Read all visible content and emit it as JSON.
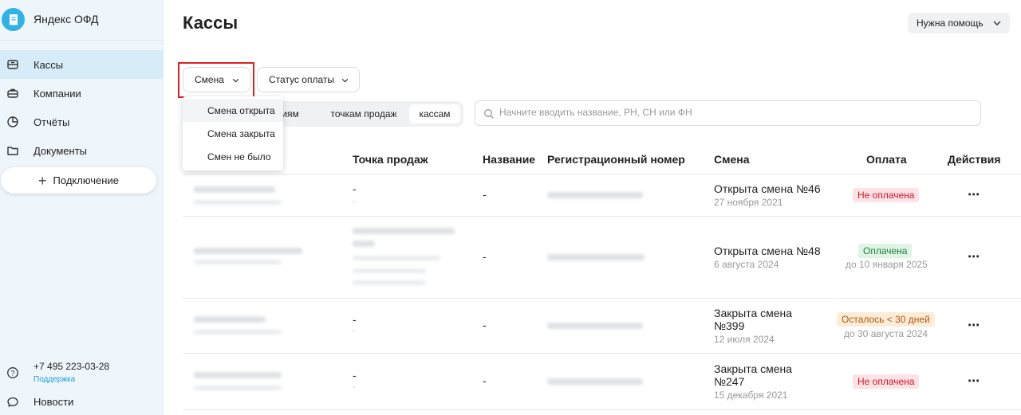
{
  "brand": {
    "name": "Яндекс ОФД"
  },
  "sidebar": {
    "items": [
      {
        "label": "Кассы"
      },
      {
        "label": "Компании"
      },
      {
        "label": "Отчёты"
      },
      {
        "label": "Документы"
      }
    ],
    "connect_label": "Подключение",
    "phone": "+7 495 223-03-28",
    "support_label": "Поддержка",
    "news_label": "Новости"
  },
  "header": {
    "title": "Кассы",
    "help_label": "Нужна помощь"
  },
  "filters": {
    "shift_label": "Смена",
    "payment_label": "Статус оплаты",
    "group_partial": "иям",
    "group_points": "точкам продаж",
    "group_registers": "кассам",
    "search_placeholder": "Начните вводить название, РН, СН или ФН"
  },
  "shift_dropdown": {
    "options": [
      "Смена открыта",
      "Смена закрыта",
      "Смен не было"
    ]
  },
  "table": {
    "headers": {
      "point": "Точка продаж",
      "name": "Название",
      "reg": "Регистрационный номер",
      "shift": "Смена",
      "payment": "Оплата",
      "actions": "Действия"
    },
    "rows": [
      {
        "point": "-",
        "point_sub": "-",
        "name": "-",
        "shift_l1": "Открыта смена №46",
        "shift_l2": "",
        "shift_date": "27 ноября 2021",
        "payment": "Не оплачена",
        "payment_sub": "",
        "dots": "⋯"
      },
      {
        "point": "",
        "point_sub": "",
        "name": "-",
        "shift_l1": "Открыта смена №48",
        "shift_l2": "",
        "shift_date": "6 августа 2024",
        "payment": "Оплачена",
        "payment_sub": "до 10 января 2025",
        "dots": "⋯"
      },
      {
        "point": "-",
        "point_sub": "-",
        "name": "-",
        "shift_l1": "Закрыта смена",
        "shift_l2": "№399",
        "shift_date": "12 июля 2024",
        "payment": "Осталось < 30 дней",
        "payment_sub": "до 30 августа 2024",
        "dots": "⋯"
      },
      {
        "point": "-",
        "point_sub": "-",
        "name": "-",
        "shift_l1": "Закрыта смена",
        "shift_l2": "№247",
        "shift_date": "15 декабря 2021",
        "payment": "Не оплачена",
        "payment_sub": "",
        "dots": "⋯"
      }
    ]
  },
  "colors": {
    "accent": "#2fb3e6",
    "sidebar_bg": "#eef5fb",
    "active_bg": "#d6ecf9",
    "unpaid": "#d3132b",
    "paid": "#1f7a3c",
    "warning": "#b2560c",
    "highlight": "#e02020"
  }
}
